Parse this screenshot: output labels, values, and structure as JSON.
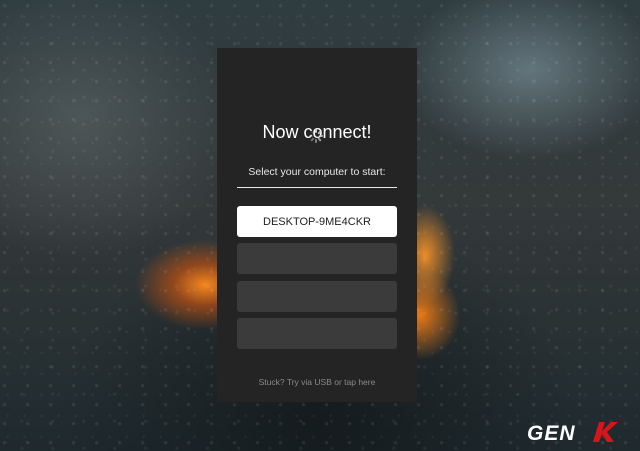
{
  "dialog": {
    "title": "Now connect!",
    "prompt": "Select your computer to start:",
    "devices": [
      {
        "label": "DESKTOP-9ME4CKR",
        "selected": true
      },
      {
        "label": "",
        "selected": false
      },
      {
        "label": "",
        "selected": false
      },
      {
        "label": "",
        "selected": false
      }
    ],
    "footer_link": "Stuck? Try via USB or tap here"
  },
  "watermark": {
    "text": "GENK"
  },
  "colors": {
    "panel_bg": "#242424",
    "selected_device_bg": "#ffffff",
    "empty_slot_bg": "#3b3b3b",
    "footer_text": "#8a8a8a",
    "watermark_red": "#d4151c"
  },
  "icons": {
    "loading": "loading-spinner-icon",
    "watermark": "genk-logo"
  }
}
